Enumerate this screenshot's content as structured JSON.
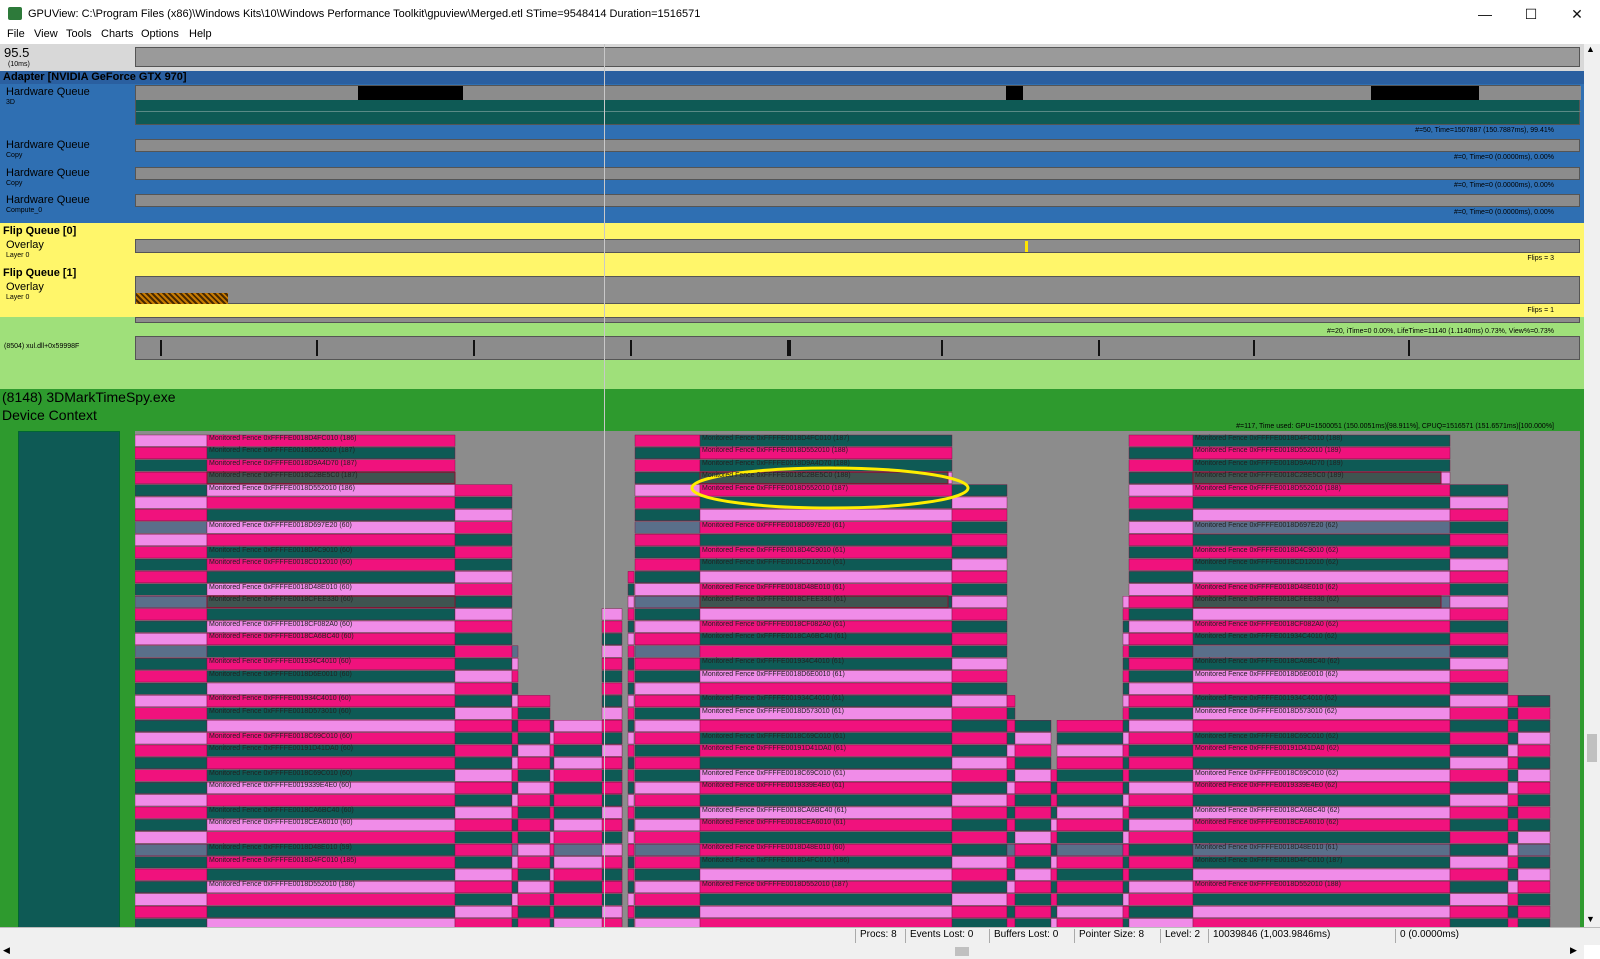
{
  "window": {
    "title": "GPUView: C:\\Program Files (x86)\\Windows Kits\\10\\Windows Performance Toolkit\\gpuview\\Merged.etl STime=9548414 Duration=1516571",
    "controls": {
      "minimize": "—",
      "maximize": "☐",
      "close": "✕"
    }
  },
  "menu": [
    "File",
    "View",
    "Tools",
    "Charts",
    "Options",
    "Help"
  ],
  "timeline": {
    "value": "95.5",
    "unit": "(10ms)"
  },
  "adapter": {
    "title": "Adapter [NVIDIA GeForce GTX 970]",
    "queues": [
      {
        "label": "Hardware Queue",
        "sub": "3D",
        "stat": "#=50,  Time=1507887 (150.7887ms),  99.41%"
      },
      {
        "label": "Hardware Queue",
        "sub": "Copy",
        "stat": "#=0,  Time=0 (0.0000ms),  0.00%"
      },
      {
        "label": "Hardware Queue",
        "sub": "Copy",
        "stat": "#=0,  Time=0 (0.0000ms),  0.00%"
      },
      {
        "label": "Hardware Queue",
        "sub": "Compute_0",
        "stat": "#=0,  Time=0 (0.0000ms),  0.00%"
      }
    ]
  },
  "flip_queues": [
    {
      "title": "Flip Queue [0]",
      "label": "Overlay",
      "sub": "Layer 0",
      "stat": "Flips = 3"
    },
    {
      "title": "Flip Queue [1]",
      "label": "Overlay",
      "sub": "Layer 0",
      "stat": "Flips = 1"
    }
  ],
  "thread": {
    "stat": "#=20,  iTime=0  0.00%,  LifeTime=11140 (1.1140ms)  0.73%,  View%=0.73%",
    "label": "(8504) xul.dll+0x59998F"
  },
  "process": {
    "title": "(8148) 3DMarkTimeSpy.exe",
    "context": "Device Context",
    "stat": "#=117, Time used: GPU=1500051 (150.0051ms)[98.911%], CPUQ=1516571 (151.6571ms)[100.000%]"
  },
  "fences": {
    "col1": [
      "Monitored Fence 0xFFFFE0018D4FC010 (186)",
      "Monitored Fence 0xFFFFE0018D552010 (187)",
      "Monitored Fence 0xFFFFE0018D9A4D70 (187)",
      "Monitored Fence 0xFFFFE0018C2BE5C0 (187)",
      "Monitored Fence 0xFFFFE0018D552010 (186)",
      "Monitored Fence 0xFFFFE0018D697E20 (60)",
      "Monitored Fence 0xFFFFE0018D4C9010 (60)",
      "Monitored Fence 0xFFFFE0018CD12010 (60)",
      "Monitored Fence 0xFFFFE0018D48E010 (60)",
      "Monitored Fence 0xFFFFE0018CFEE330 (60)",
      "Monitored Fence 0xFFFFE0018CF082A0 (60)",
      "Monitored Fence 0xFFFFE0018CA6BC40 (60)",
      "Monitored Fence 0xFFFFE001934C4010 (60)",
      "Monitored Fence 0xFFFFE0018D6E0010 (60)",
      "Monitored Fence 0xFFFFE001934C4010 (60)",
      "Monitored Fence 0xFFFFE0018D573010 (60)",
      "Monitored Fence 0xFFFFE0018C69C010 (60)",
      "Monitored Fence 0xFFFFE00191D41DA0 (60)",
      "Monitored Fence 0xFFFFE0018C69C010 (60)",
      "Monitored Fence 0xFFFFE0019339E4E0 (60)",
      "Monitored Fence 0xFFFFE0018CA6BC40 (60)",
      "Monitored Fence 0xFFFFE0018CEA6010 (60)",
      "Monitored Fence 0xFFFFE0018D48E010 (59)",
      "Monitored Fence 0xFFFFE0018D4FC010 (185)",
      "Monitored Fence 0xFFFFE0018D552010 (186)"
    ],
    "col2": [
      "Monitored Fence 0xFFFFE0018D4FC010 (187)",
      "Monitored Fence 0xFFFFE0018D552010 (188)",
      "Monitored Fence 0xFFFFE0018D9A4D70 (188)",
      "Monitored Fence 0xFFFFE0018C2BE5C0 (188)",
      "Monitored Fence 0xFFFFE0018D552010 (187)",
      "Monitored Fence 0xFFFFE0018D697E20 (61)",
      "Monitored Fence 0xFFFFE0018D4C9010 (61)",
      "Monitored Fence 0xFFFFE0018CD12010 (61)",
      "Monitored Fence 0xFFFFE0018D48E010 (61)",
      "Monitored Fence 0xFFFFE0018CFEE330 (61)",
      "Monitored Fence 0xFFFFE0018CF082A0 (61)",
      "Monitored Fence 0xFFFFE0018CA6BC40 (61)",
      "Monitored Fence 0xFFFFE001934C4010 (61)",
      "Monitored Fence 0xFFFFE0018D6E0010 (61)",
      "Monitored Fence 0xFFFFE001934C4010 (61)",
      "Monitored Fence 0xFFFFE0018D573010 (61)",
      "Monitored Fence 0xFFFFE0018C69C010 (61)",
      "Monitored Fence 0xFFFFE00191D41DA0 (61)",
      "Monitored Fence 0xFFFFE0018C69C010 (61)",
      "Monitored Fence 0xFFFFE0019339E4E0 (61)",
      "Monitored Fence 0xFFFFE0018CA6BC40 (61)",
      "Monitored Fence 0xFFFFE0018CEA6010 (61)",
      "Monitored Fence 0xFFFFE0018D48E010 (60)",
      "Monitored Fence 0xFFFFE0018D4FC010 (186)",
      "Monitored Fence 0xFFFFE0018D552010 (187)"
    ],
    "col3": [
      "Monitored Fence 0xFFFFE0018D4FC010 (188)",
      "Monitored Fence 0xFFFFE0018D552010 (189)",
      "Monitored Fence 0xFFFFE0018D9A4D70 (189)",
      "Monitored Fence 0xFFFFE0018C2BE5C0 (189)",
      "Monitored Fence 0xFFFFE0018D552010 (188)",
      "Monitored Fence 0xFFFFE0018D697E20 (62)",
      "Monitored Fence 0xFFFFE0018D4C9010 (62)",
      "Monitored Fence 0xFFFFE0018CD12010 (62)",
      "Monitored Fence 0xFFFFE0018D48E010 (62)",
      "Monitored Fence 0xFFFFE0018CFEE330 (62)",
      "Monitored Fence 0xFFFFE0018CF082A0 (62)",
      "Monitored Fence 0xFFFFE001934C4010 (62)",
      "Monitored Fence 0xFFFFE0018CA6BC40 (62)",
      "Monitored Fence 0xFFFFE0018D6E0010 (62)",
      "Monitored Fence 0xFFFFE001934C4010 (62)",
      "Monitored Fence 0xFFFFE0018D573010 (62)",
      "Monitored Fence 0xFFFFE0018C69C010 (62)",
      "Monitored Fence 0xFFFFE00191D41DA0 (62)",
      "Monitored Fence 0xFFFFE0018C69C010 (62)",
      "Monitored Fence 0xFFFFE0019339E4E0 (62)",
      "Monitored Fence 0xFFFFE0018CA6BC40 (62)",
      "Monitored Fence 0xFFFFE0018CEA6010 (62)",
      "Monitored Fence 0xFFFFE0018D48E010 (61)",
      "Monitored Fence 0xFFFFE0018D4FC010 (187)",
      "Monitored Fence 0xFFFFE0018D552010 (188)"
    ]
  },
  "status": {
    "procs": "Procs: 8",
    "events_lost": "Events Lost: 0",
    "buffers_lost": "Buffers Lost: 0",
    "pointer_size": "Pointer Size: 8",
    "level": "Level: 2",
    "time": "10039846 (1,003.9846ms)",
    "selection": "0 (0.0000ms)"
  },
  "colors": {
    "adapter_blue": "#2f6fb2",
    "flip_yellow": "#fff66a",
    "thread_green": "#9fe07a",
    "process_green": "#2e9a2e",
    "fence_pink": "#f0127d",
    "fence_teal": "#0e5a55",
    "fence_light": "#f08ce8",
    "highlight": "#ffee00"
  }
}
